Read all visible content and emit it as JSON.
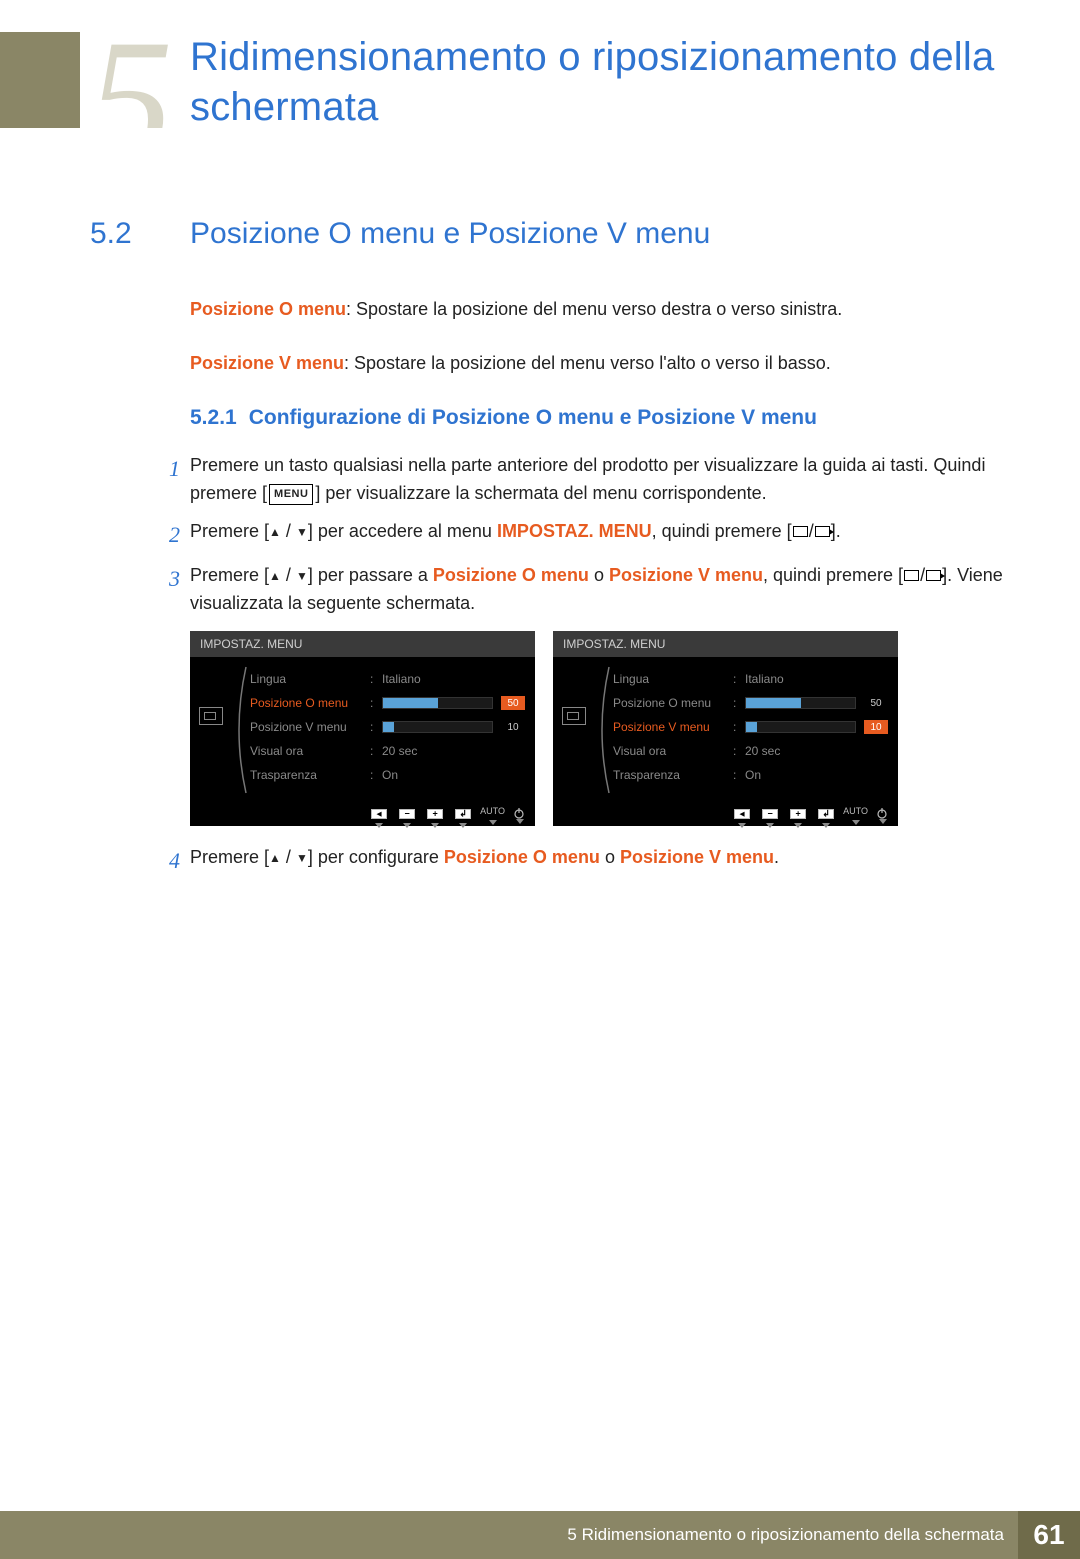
{
  "chapter_number": "5",
  "page_title": "Ridimensionamento o riposizionamento della schermata",
  "section": {
    "num": "5.2",
    "title": "Posizione O menu e Posizione V menu"
  },
  "intro": {
    "line1_label": "Posizione O menu",
    "line1_rest": ": Spostare la posizione del menu verso destra o verso sinistra.",
    "line2_label": "Posizione V menu",
    "line2_rest": ": Spostare la posizione del menu verso l'alto o verso il basso."
  },
  "subsection": {
    "num": "5.2.1",
    "title": "Configurazione di Posizione O menu e Posizione V menu"
  },
  "steps": {
    "s1_a": "Premere un tasto qualsiasi nella parte anteriore del prodotto per visualizzare la guida ai tasti. Quindi premere [",
    "s1_menu": "MENU",
    "s1_b": "] per visualizzare la schermata del menu corrispondente.",
    "s2_a": "Premere [",
    "s2_b": "] per accedere al menu ",
    "s2_c": "IMPOSTAZ. MENU",
    "s2_d": ", quindi premere [",
    "s2_e": "].",
    "s3_a": "Premere [",
    "s3_b": "] per passare a ",
    "s3_c": "Posizione O menu",
    "s3_d": " o ",
    "s3_e": "Posizione V menu",
    "s3_f": ", quindi premere [",
    "s3_g": "]. Viene visualizzata la seguente schermata.",
    "s4_a": "Premere [",
    "s4_b": "] per configurare ",
    "s4_c": "Posizione O menu",
    "s4_d": " o ",
    "s4_e": "Posizione V menu",
    "s4_f": "."
  },
  "osd": {
    "header": "IMPOSTAZ. MENU",
    "items": {
      "lingua": "Lingua",
      "pos_o": "Posizione O menu",
      "pos_v": "Posizione V menu",
      "visual": "Visual ora",
      "trasp": "Trasparenza"
    },
    "vals": {
      "lingua": "Italiano",
      "pos_o": "50",
      "pos_v": "10",
      "visual": "20 sec",
      "trasp": "On"
    },
    "footer_auto": "AUTO"
  },
  "footer": {
    "text": "5 Ridimensionamento o riposizionamento della schermata",
    "page": "61"
  }
}
